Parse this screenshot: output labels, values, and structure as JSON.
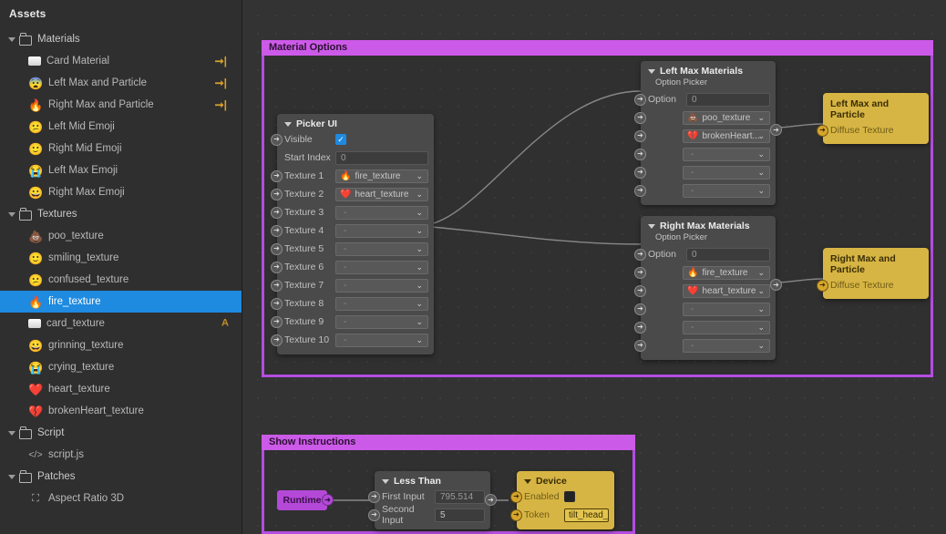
{
  "sidebar": {
    "title": "Assets",
    "items": [
      {
        "label": "Materials",
        "type": "folder",
        "depth": 0,
        "expanded": true
      },
      {
        "label": "Card Material",
        "type": "asset",
        "depth": 1,
        "icon": "card-icon",
        "badge": "export-arrow"
      },
      {
        "label": "Left Max and Particle",
        "type": "asset",
        "depth": 1,
        "icon": "😨",
        "badge": "export-arrow"
      },
      {
        "label": "Right Max and Particle",
        "type": "asset",
        "depth": 1,
        "icon": "🔥",
        "badge": "export-arrow"
      },
      {
        "label": "Left Mid Emoji",
        "type": "asset",
        "depth": 1,
        "icon": "😕",
        "badge": ""
      },
      {
        "label": "Right Mid Emoji",
        "type": "asset",
        "depth": 1,
        "icon": "🙂",
        "badge": ""
      },
      {
        "label": "Left Max Emoji",
        "type": "asset",
        "depth": 1,
        "icon": "😭",
        "badge": ""
      },
      {
        "label": "Right Max Emoji",
        "type": "asset",
        "depth": 1,
        "icon": "😀",
        "badge": ""
      },
      {
        "label": "Textures",
        "type": "folder",
        "depth": 0,
        "expanded": true
      },
      {
        "label": "poo_texture",
        "type": "asset",
        "depth": 1,
        "icon": "💩",
        "badge": ""
      },
      {
        "label": "smiling_texture",
        "type": "asset",
        "depth": 1,
        "icon": "🙂",
        "badge": ""
      },
      {
        "label": "confused_texture",
        "type": "asset",
        "depth": 1,
        "icon": "😕",
        "badge": ""
      },
      {
        "label": "fire_texture",
        "type": "asset",
        "depth": 1,
        "icon": "🔥",
        "badge": "",
        "selected": true
      },
      {
        "label": "card_texture",
        "type": "asset",
        "depth": 1,
        "icon": "card-icon",
        "badge": "A"
      },
      {
        "label": "grinning_texture",
        "type": "asset",
        "depth": 1,
        "icon": "😀",
        "badge": ""
      },
      {
        "label": "crying_texture",
        "type": "asset",
        "depth": 1,
        "icon": "😭",
        "badge": ""
      },
      {
        "label": "heart_texture",
        "type": "asset",
        "depth": 1,
        "icon": "❤️",
        "badge": ""
      },
      {
        "label": "brokenHeart_texture",
        "type": "asset",
        "depth": 1,
        "icon": "💔",
        "badge": ""
      },
      {
        "label": "Script",
        "type": "folder",
        "depth": 0,
        "expanded": true
      },
      {
        "label": "script.js",
        "type": "script",
        "depth": 1,
        "icon": "code-icon",
        "badge": ""
      },
      {
        "label": "Patches",
        "type": "folder",
        "depth": 0,
        "expanded": true
      },
      {
        "label": "Aspect Ratio 3D",
        "type": "patch",
        "depth": 1,
        "icon": "patch-icon",
        "badge": ""
      }
    ]
  },
  "canvas": {
    "groups": [
      {
        "name": "material_options",
        "title": "Material Options"
      },
      {
        "name": "show_instructions",
        "title": "Show Instructions"
      }
    ],
    "picker_ui": {
      "title": "Picker UI",
      "visible_label": "Visible",
      "visible_checked": true,
      "start_index_label": "Start Index",
      "start_index_value": "0",
      "textures": [
        {
          "label": "Texture 1",
          "value": "fire_texture",
          "icon": "🔥"
        },
        {
          "label": "Texture 2",
          "value": "heart_texture",
          "icon": "❤️"
        },
        {
          "label": "Texture 3",
          "value": "-",
          "icon": ""
        },
        {
          "label": "Texture 4",
          "value": "-",
          "icon": ""
        },
        {
          "label": "Texture 5",
          "value": "-",
          "icon": ""
        },
        {
          "label": "Texture 6",
          "value": "-",
          "icon": ""
        },
        {
          "label": "Texture 7",
          "value": "-",
          "icon": ""
        },
        {
          "label": "Texture 8",
          "value": "-",
          "icon": ""
        },
        {
          "label": "Texture 9",
          "value": "-",
          "icon": ""
        },
        {
          "label": "Texture 10",
          "value": "-",
          "icon": ""
        }
      ]
    },
    "left_max_materials": {
      "title": "Left Max Materials",
      "subtitle": "Option Picker",
      "option_label": "Option",
      "option_value": "0",
      "options": [
        {
          "value": "poo_texture",
          "icon": "💩"
        },
        {
          "value": "brokenHeart...",
          "icon": "💔"
        },
        {
          "value": "-",
          "icon": ""
        },
        {
          "value": "-",
          "icon": ""
        },
        {
          "value": "-",
          "icon": ""
        }
      ]
    },
    "right_max_materials": {
      "title": "Right Max Materials",
      "subtitle": "Option Picker",
      "option_label": "Option",
      "option_value": "0",
      "options": [
        {
          "value": "fire_texture",
          "icon": "🔥"
        },
        {
          "value": "heart_texture",
          "icon": "❤️"
        },
        {
          "value": "-",
          "icon": ""
        },
        {
          "value": "-",
          "icon": ""
        },
        {
          "value": "-",
          "icon": ""
        }
      ]
    },
    "left_max_particle": {
      "title": "Left Max and Particle",
      "input_label": "Diffuse Texture"
    },
    "right_max_particle": {
      "title": "Right Max and Particle",
      "input_label": "Diffuse Texture"
    },
    "runtime": {
      "label": "Runtime"
    },
    "less_than": {
      "title": "Less Than",
      "first_input_label": "First Input",
      "first_input_value": "795.514",
      "second_input_label": "Second Input",
      "second_input_value": "5"
    },
    "device": {
      "title": "Device",
      "enabled_label": "Enabled",
      "enabled_checked": false,
      "token_label": "Token",
      "token_value": "tilt_head_r"
    }
  },
  "colors": {
    "accent_group": "#b44de0",
    "group_header": "#cc5ae8",
    "selection": "#1e8ae0",
    "node_yellow": "#d7b544",
    "runtime_purple": "#b449d8",
    "export_arrow": "#d8a227"
  }
}
